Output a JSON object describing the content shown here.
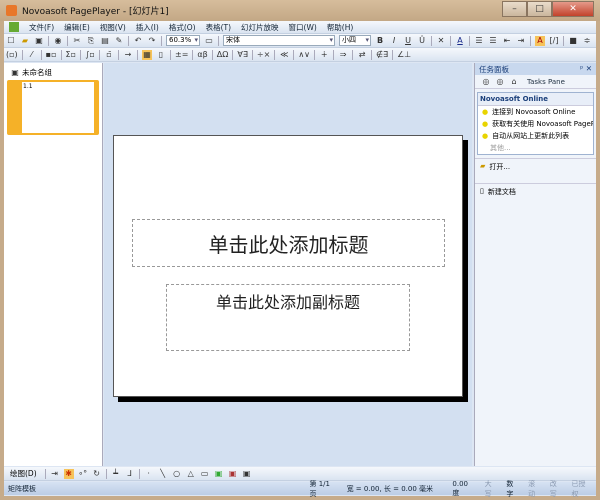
{
  "window": {
    "title": "Novoasoft PagePlayer - [幻灯片1]"
  },
  "menu": [
    "文件(F)",
    "编辑(E)",
    "视图(V)",
    "插入(I)",
    "格式(O)",
    "表格(T)",
    "幻灯片放映",
    "窗口(W)",
    "帮助(H)"
  ],
  "toolbar": {
    "zoom": "60.3%",
    "font": "宋体",
    "size": "小四"
  },
  "slides_panel": {
    "group": "未命名组",
    "thumb_label": "1.1"
  },
  "slide": {
    "title_placeholder": "单击此处添加标题",
    "subtitle_placeholder": "单击此处添加副标题"
  },
  "task_pane": {
    "title": "任务面板",
    "nav_label": "Tasks Pane",
    "section_title": "Novoasoft Online",
    "links": [
      "连接到 Novoasoft Online",
      "获取有关使用 Novoasoft PageP...",
      "自动从网站上更新此列表"
    ],
    "more": "其他...",
    "open": "打开...",
    "new_doc": "新建文档"
  },
  "drawbar": {
    "label": "绘图(D)"
  },
  "status": {
    "mode": "矩阵模板",
    "page": "第 1/1 页",
    "dims": "宽 = 0.00, 长 = 0.00 毫米",
    "angle": "0.00 度",
    "caps": "大写",
    "num": "数字",
    "scroll": "滚动",
    "ovr": "改写",
    "auth": "已授权"
  }
}
